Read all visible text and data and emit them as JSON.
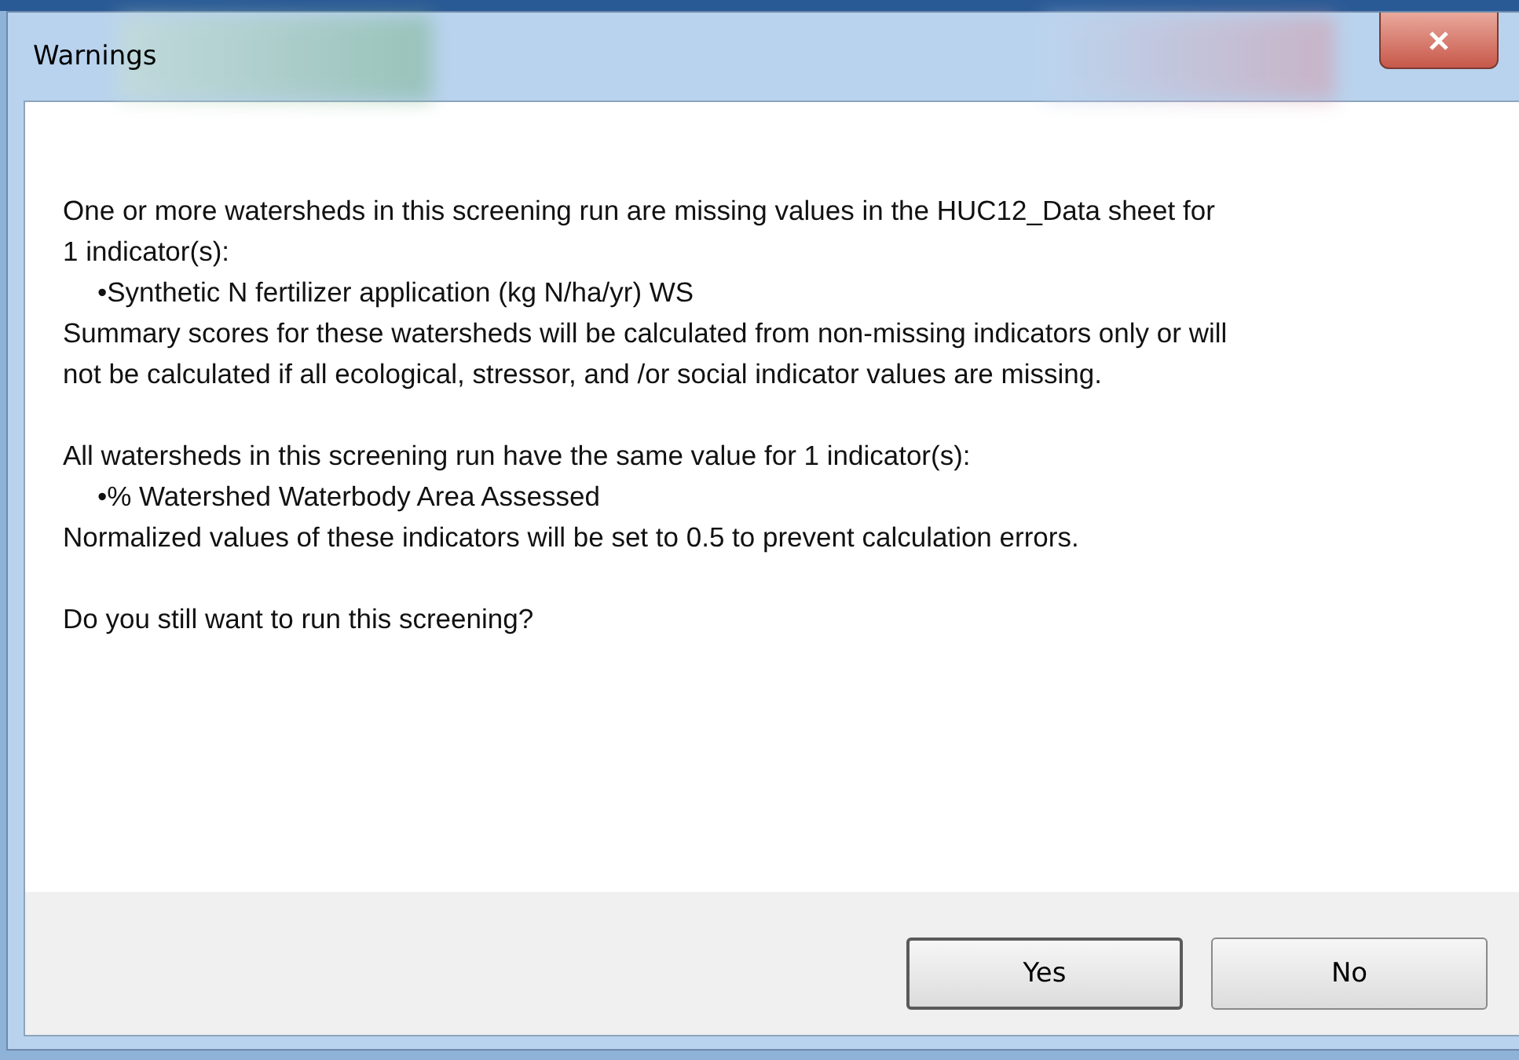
{
  "window": {
    "title": "Warnings"
  },
  "message": [
    {
      "kind": "text",
      "text": "One or more watersheds in this screening run are missing values in the HUC12_Data sheet for 1 indicator(s):"
    },
    {
      "kind": "bullet",
      "text": "•Synthetic N fertilizer application (kg N/ha/yr) WS"
    },
    {
      "kind": "text",
      "text": "Summary scores for these watersheds will be calculated from non-missing indicators only or will not be calculated if all ecological, stressor, and /or social indicator values are missing."
    },
    {
      "kind": "gap"
    },
    {
      "kind": "text",
      "text": "All watersheds in this screening run have the same value for 1 indicator(s):"
    },
    {
      "kind": "bullet",
      "text": "•% Watershed Waterbody Area Assessed"
    },
    {
      "kind": "text",
      "text": "Normalized values of these indicators will be set to 0.5 to prevent calculation errors."
    },
    {
      "kind": "gap"
    },
    {
      "kind": "text",
      "text": "Do you still want to run this screening?"
    }
  ],
  "buttons": [
    {
      "label": "Yes",
      "default": true
    },
    {
      "label": "No",
      "default": false
    }
  ]
}
